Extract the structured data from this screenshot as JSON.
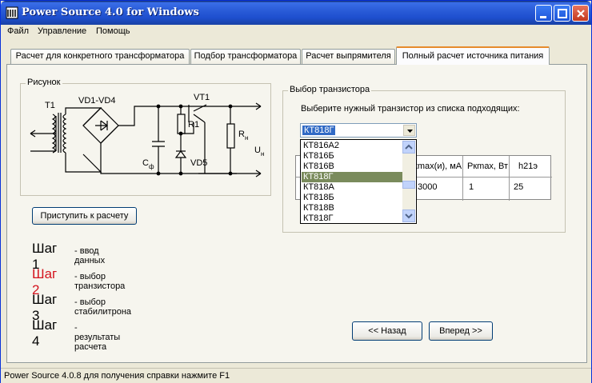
{
  "window": {
    "title": "Power Source 4.0 for Windows"
  },
  "menu": [
    "Файл",
    "Управление",
    "Помощь"
  ],
  "tabs": [
    "Расчет для конкретного трансформатора",
    "Подбор трансформатора",
    "Расчет выпрямителя",
    "Полный расчет источника питания"
  ],
  "active_tab": 3,
  "diagram": {
    "group_label": "Рисунок",
    "labels": {
      "t1": "T1",
      "bridge": "VD1-VD4",
      "vt1": "VT1",
      "r1": "R1",
      "rn": "R",
      "rn_sub": "н",
      "un": "U",
      "un_sub": "н",
      "cf": "C",
      "cf_sub": "ф",
      "vd5": "VD5"
    }
  },
  "start_button": "Приступить к расчету",
  "steps": [
    {
      "label": "Шаг 1",
      "desc": "- ввод данных",
      "color": "#000000"
    },
    {
      "label": "Шаг 2",
      "desc": "- выбор транзистора",
      "color": "#d4141e"
    },
    {
      "label": "Шаг 3",
      "desc": "- выбор стабилитрона",
      "color": "#000000"
    },
    {
      "label": "Шаг 4",
      "desc": "- результаты расчета",
      "color": "#000000"
    }
  ],
  "transistor": {
    "group_label": "Выбор транзистора",
    "prompt": "Выберите нужный транзистор из списка подходящих:",
    "selected": "КТ818Г",
    "options": [
      "КТ816А2",
      "КТ816Б",
      "КТ816В",
      "КТ818Г",
      "КТ818А",
      "КТ818Б",
      "КТ818В",
      "КТ818Г"
    ],
    "selected_index": 3,
    "table_headers": [
      "Iкmax(и), мА",
      "Pкmax, Вт",
      "h21э"
    ],
    "table_row": [
      "3000",
      "1",
      "25"
    ]
  },
  "nav": {
    "back": "<< Назад",
    "next": "Вперед >>"
  },
  "status": "Power Source 4.0.8 для получения справки нажмите F1",
  "colors": {
    "accent_tab": "#e68b2c",
    "titlebar": "#1e4fcf",
    "step_active": "#d4141e"
  }
}
